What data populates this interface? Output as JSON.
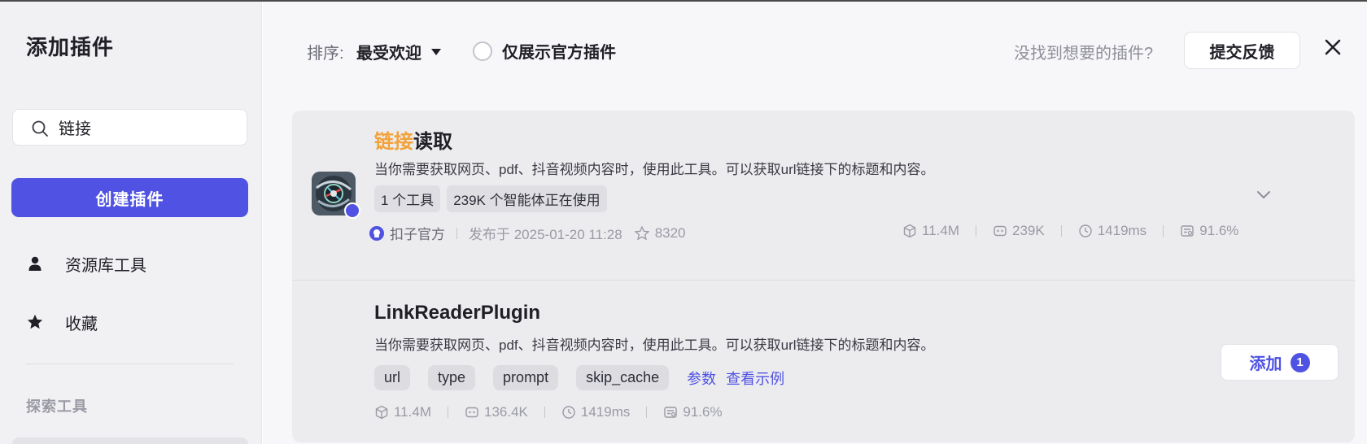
{
  "sidebar": {
    "title": "添加插件",
    "search": {
      "value": "链接",
      "placeholder": ""
    },
    "create_button": "创建插件",
    "nav": [
      {
        "label": "资源库工具",
        "icon": "user-icon"
      },
      {
        "label": "收藏",
        "icon": "star-icon"
      }
    ],
    "section_label": "探索工具"
  },
  "toolbar": {
    "sort_label": "排序:",
    "sort_value": "最受欢迎",
    "official_only_label": "仅展示官方插件",
    "not_found_text": "没找到想要的插件?",
    "feedback_button": "提交反馈",
    "close_icon": "close-icon"
  },
  "plugin": {
    "title_highlight": "链接",
    "title_rest": "读取",
    "description": "当你需要获取网页、pdf、抖音视频内容时，使用此工具。可以获取url链接下的标题和内容。",
    "tags": [
      "1 个工具",
      "239K 个智能体正在使用"
    ],
    "author": "扣子官方",
    "published": "发布于 2025-01-20 11:28",
    "favorites": "8320",
    "stats": {
      "calls": "11.4M",
      "bots": "239K",
      "latency": "1419ms",
      "success_rate": "91.6%"
    }
  },
  "tool": {
    "name": "LinkReaderPlugin",
    "description": "当你需要获取网页、pdf、抖音视频内容时，使用此工具。可以获取url链接下的标题和内容。",
    "params": [
      "url",
      "type",
      "prompt",
      "skip_cache"
    ],
    "params_link": "参数",
    "example_link": "查看示例",
    "stats": {
      "calls": "11.4M",
      "bots": "136.4K",
      "latency": "1419ms",
      "success_rate": "91.6%"
    },
    "add_button": "添加",
    "add_count": "1"
  },
  "colors": {
    "accent": "#4f52e2",
    "highlight": "#f2a23a",
    "sidebar_bg": "#f1f1f4",
    "card_bg": "#ececef"
  }
}
